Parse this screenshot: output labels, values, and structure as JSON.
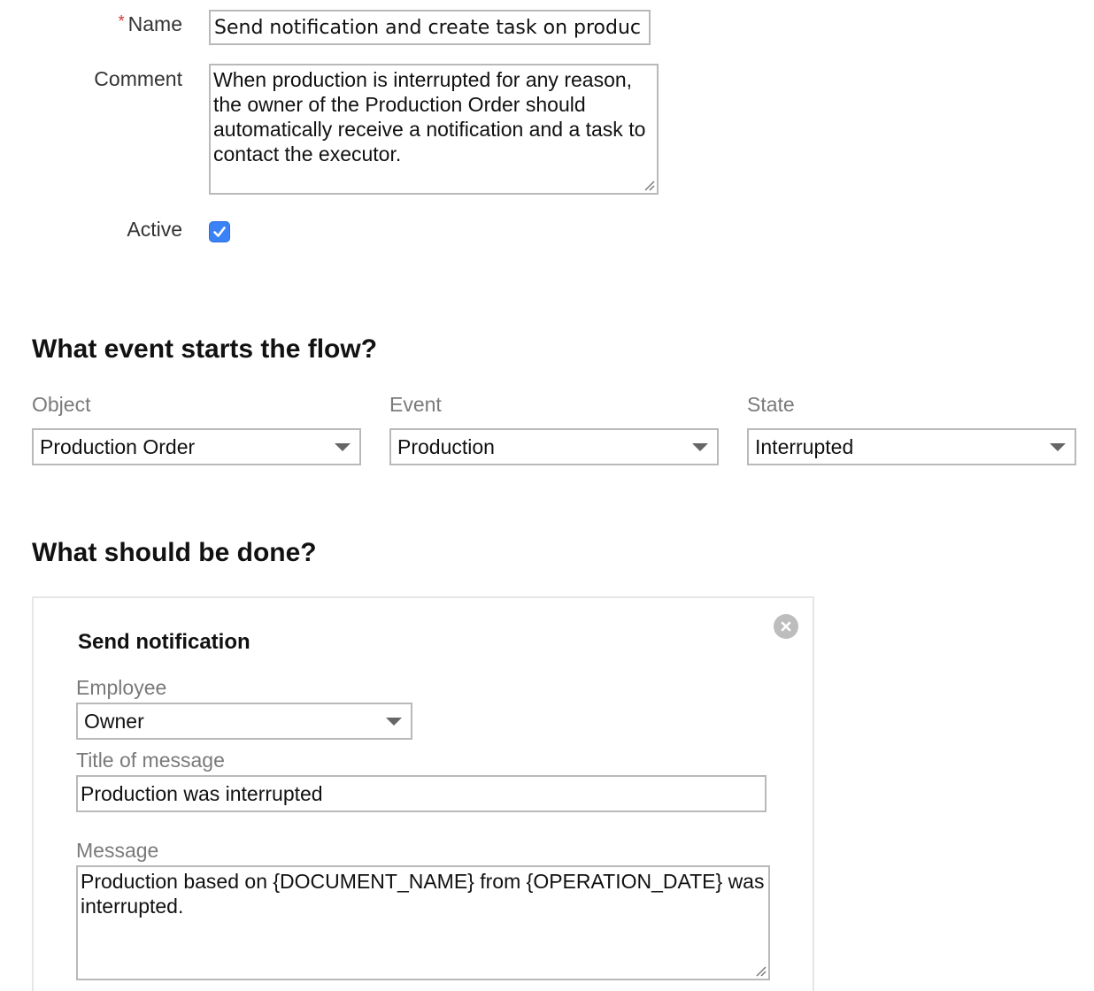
{
  "form": {
    "name_label": "Name",
    "name_value": "Send notification and create task on produc",
    "comment_label": "Comment",
    "comment_value": "When production is interrupted for any reason, the owner of the Production Order should automatically receive a notification and a task to contact the executor.",
    "active_label": "Active",
    "active_checked": true,
    "required_marker": "*"
  },
  "trigger": {
    "heading": "What event starts the flow?",
    "object_label": "Object",
    "object_value": "Production Order",
    "event_label": "Event",
    "event_value": "Production",
    "state_label": "State",
    "state_value": "Interrupted"
  },
  "actions": {
    "heading": "What should be done?",
    "notification": {
      "title": "Send notification",
      "employee_label": "Employee",
      "employee_value": "Owner",
      "message_title_label": "Title of message",
      "message_title_value": "Production was interrupted",
      "message_label": "Message",
      "message_value": "Production based on {DOCUMENT_NAME} from {OPERATION_DATE} was interrupted."
    }
  },
  "colors": {
    "accent": "#3b82f6",
    "required": "#d0342c",
    "caption": "#7a7a7a",
    "border": "#b9b9b9"
  },
  "icons": {
    "checkbox": "checkmark-icon",
    "select": "dropdown-arrow-icon",
    "close": "close-icon",
    "resize": "resize-grip-icon"
  }
}
